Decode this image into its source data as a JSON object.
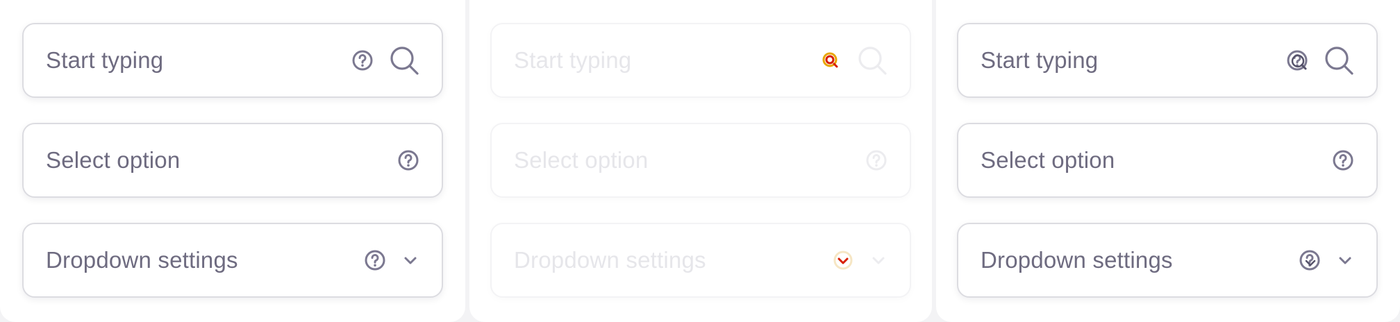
{
  "colors": {
    "label": "#6e6b80",
    "label_disabled": "#e6e6ea",
    "border": "#dcdce1",
    "icon": "#7b7890",
    "icon_disabled": "#ececef",
    "focus_ring": "#e8a600",
    "focus_mark": "#d81f00"
  },
  "panels": [
    {
      "state": "default",
      "fields": [
        {
          "label": "Start typing",
          "type": "search",
          "icons": [
            "help-icon",
            "search-icon"
          ]
        },
        {
          "label": "Select option",
          "type": "select",
          "icons": [
            "help-icon"
          ]
        },
        {
          "label": "Dropdown settings",
          "type": "dropdown",
          "icons": [
            "help-icon",
            "chevron-down-icon"
          ]
        }
      ]
    },
    {
      "state": "disabled",
      "fields": [
        {
          "label": "Start typing",
          "type": "search",
          "icons": [
            "help-icon",
            "search-icon"
          ]
        },
        {
          "label": "Select option",
          "type": "select",
          "icons": [
            "help-icon"
          ]
        },
        {
          "label": "Dropdown settings",
          "type": "dropdown",
          "icons": [
            "help-icon",
            "chevron-down-icon"
          ]
        }
      ]
    },
    {
      "state": "hover",
      "fields": [
        {
          "label": "Start typing",
          "type": "search",
          "icons": [
            "help-icon",
            "search-icon"
          ]
        },
        {
          "label": "Select option",
          "type": "select",
          "icons": [
            "help-icon"
          ]
        },
        {
          "label": "Dropdown settings",
          "type": "dropdown",
          "icons": [
            "help-icon",
            "chevron-down-icon"
          ]
        }
      ]
    }
  ]
}
